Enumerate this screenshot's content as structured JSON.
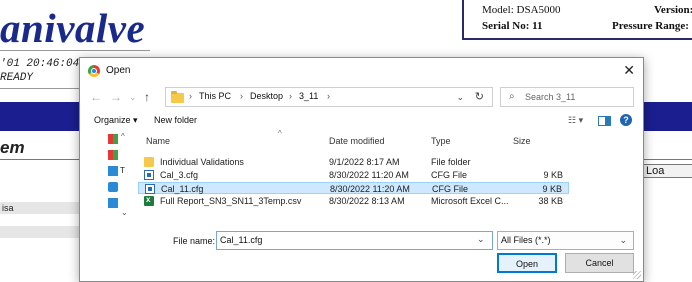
{
  "background": {
    "logo": "anivalve",
    "info": {
      "model": "Model: DSA5000",
      "version": "Version:",
      "serial": "Serial No: 11",
      "pressure_range": "Pressure Range:"
    },
    "datetime": "'01 20:46:04",
    "status": "READY",
    "section_title": "em",
    "load_button": "Loa",
    "row_label": "isa",
    "colors": {
      "brand_blue": "#1b1e8f",
      "logo_blue": "#1a2a8a"
    }
  },
  "dialog": {
    "title": "Open",
    "breadcrumb": [
      "This PC",
      "Desktop",
      "3_11"
    ],
    "search_placeholder": "Search 3_11",
    "toolbar": {
      "organize": "Organize ▾",
      "new_folder": "New folder"
    },
    "columns": [
      "Name",
      "Date modified",
      "Type",
      "Size"
    ],
    "files": [
      {
        "name": "Individual Validations",
        "date": "9/1/2022 8:17 AM",
        "type": "File folder",
        "size": "",
        "icon": "folder-icon",
        "selected": false
      },
      {
        "name": "Cal_3.cfg",
        "date": "8/30/2022 11:20 AM",
        "type": "CFG File",
        "size": "9 KB",
        "icon": "cfg-file-icon",
        "selected": false
      },
      {
        "name": "Cal_11.cfg",
        "date": "8/30/2022 11:20 AM",
        "type": "CFG File",
        "size": "9 KB",
        "icon": "cfg-file-icon",
        "selected": true
      },
      {
        "name": "Full Report_SN3_SN11_3Temp.csv",
        "date": "8/30/2022 8:13 AM",
        "type": "Microsoft Excel C...",
        "size": "38 KB",
        "icon": "excel-icon",
        "selected": false
      }
    ],
    "nav_pane_partial": "T",
    "file_name_label": "File name:",
    "file_name_value": "Cal_11.cfg",
    "file_type_filter": "All Files (*.*)",
    "open_button": "Open",
    "cancel_button": "Cancel",
    "colors": {
      "selection": "#cde8ff",
      "accent": "#0078d7"
    }
  }
}
